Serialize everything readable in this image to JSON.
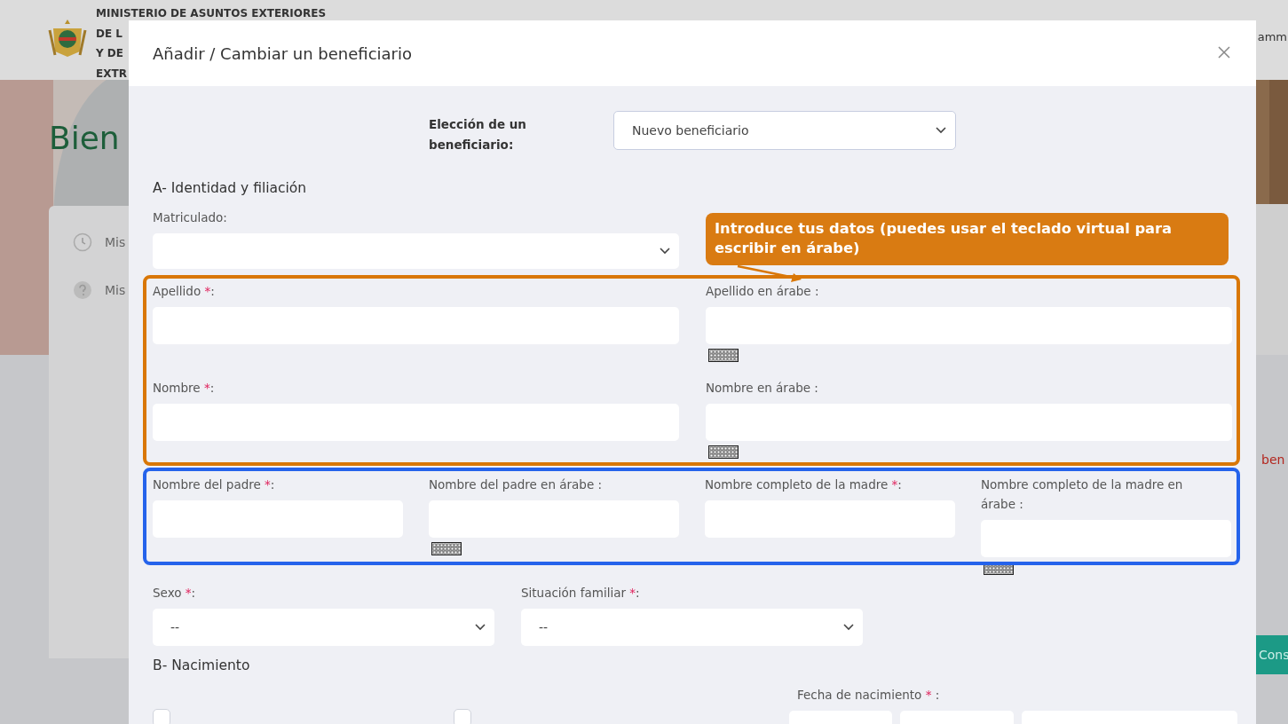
{
  "background_page": {
    "ministry_lines": [
      "MINISTERIO DE ASUNTOS EXTERIORES",
      "DE L",
      "Y DE",
      "EXTR"
    ],
    "user_name": "amm",
    "heading": "Bien",
    "menu_items": [
      {
        "label": "Mis"
      },
      {
        "label": "Mis"
      }
    ],
    "side_text": "ben",
    "side_button": "Cons"
  },
  "modal": {
    "title": "Añadir / Cambiar un beneficiario",
    "chooser": {
      "label": "Elección de un beneficiario:",
      "value": "Nuevo beneficiario"
    },
    "section_a": {
      "title": "A- Identidad y filiación",
      "matriculado": {
        "label": "Matriculado:"
      },
      "name_rows": [
        [
          {
            "label": "Apellido ",
            "required": "*",
            "after": ":",
            "keyboard": false
          },
          {
            "label": "Apellido en árabe :",
            "keyboard": true
          }
        ],
        [
          {
            "label": "Nombre ",
            "required": "*",
            "after": ":",
            "keyboard": false
          },
          {
            "label": "Nombre en árabe :",
            "keyboard": true
          }
        ]
      ],
      "parents": [
        {
          "label": "Nombre del padre ",
          "required": "*",
          "after": ":",
          "keyboard": false
        },
        {
          "label": "Nombre del padre en árabe :",
          "keyboard": true
        },
        {
          "label": "Nombre completo de la madre ",
          "required": "*",
          "after": ":",
          "keyboard": false
        },
        {
          "label": "Nombre completo de la madre en árabe :",
          "keyboard": true
        }
      ],
      "selects": [
        {
          "label": "Sexo ",
          "required": "*",
          "after": ":",
          "value": "--"
        },
        {
          "label": "Situación familiar ",
          "required": "*",
          "after": ":",
          "value": "--"
        }
      ]
    },
    "section_b": {
      "title": "B- Nacimiento",
      "checkboxes": [
        {
          "checked": false
        },
        {
          "checked": false
        }
      ],
      "birth_date": {
        "label": "Fecha de nacimiento ",
        "required": "*",
        "after": " :"
      }
    }
  },
  "annotations": {
    "callout": "Introduce tus datos (puedes usar el teclado virtual para escribir en árabe)",
    "frames": [
      {
        "color": "#d97706"
      },
      {
        "color": "#2563eb"
      }
    ]
  }
}
